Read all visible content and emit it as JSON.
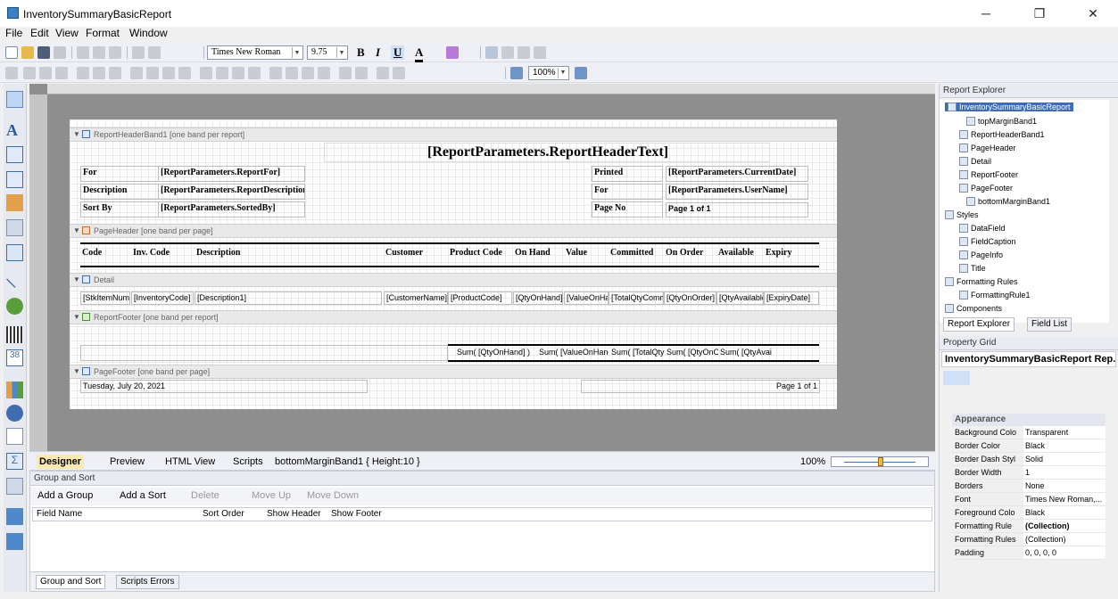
{
  "window": {
    "title": "InventorySummaryBasicReport",
    "minimize": "─",
    "maximize": "❐",
    "close": "✕"
  },
  "menu": [
    "File",
    "Edit",
    "View",
    "Format",
    "Window"
  ],
  "format_bar": {
    "font": "Times New Roman",
    "size": "9.75",
    "bold": "B",
    "italic": "I",
    "underline": "U",
    "font_color": "A"
  },
  "layout_bar": {
    "zoom": "100%"
  },
  "report": {
    "header_band": "ReportHeaderBand1 [one band per report]",
    "header_text": "[ReportParameters.ReportHeaderText]",
    "rows": [
      {
        "label": "For",
        "value": "[ReportParameters.ReportFor]",
        "rlabel": "Printed",
        "rvalue": "[ReportParameters.CurrentDate]"
      },
      {
        "label": "Description",
        "value": "[ReportParameters.ReportDescription]",
        "rlabel": "For",
        "rvalue": "[ReportParameters.UserName]"
      },
      {
        "label": "Sort By",
        "value": "[ReportParameters.SortedBy]",
        "rlabel": "Page No",
        "rvalue": "Page 1 of 1"
      }
    ],
    "page_header_band": "PageHeader [one band per page]",
    "columns": [
      "Code",
      "Inv. Code",
      "Description",
      "Customer",
      "Product Code",
      "On Hand",
      "Value",
      "Committed",
      "On Order",
      "Available",
      "Expiry"
    ],
    "detail_band": "Detail",
    "detail_fields": [
      "[StkItemNum]",
      "[InventoryCode]",
      "[Description1]",
      "[CustomerName]",
      "[ProductCode]",
      "[QtyOnHand]",
      "[ValueOnHand]",
      "[TotalQtyCommitted]",
      "[QtyOnOrder]",
      "[QtyAvailable]",
      "[ExpiryDate]"
    ],
    "footer_band": "ReportFooter [one band per report]",
    "footer_sums": [
      "Sum( [QtyOnHand] )",
      "Sum( [ValueOnHand] )",
      "Sum( [TotalQtyCommitted] )",
      "Sum( [QtyOnOrder] )",
      "Sum( [QtyAvailable] )"
    ],
    "page_footer_band": "PageFooter [one band per page]",
    "page_footer_date": "Tuesday, July 20, 2021",
    "page_footer_pages": "Page 1 of 1"
  },
  "designer_tabs": {
    "designer": "Designer",
    "preview": "Preview",
    "html": "HTML View",
    "scripts": "Scripts",
    "selection": "bottomMarginBand1 { Height:10 }",
    "zoom": "100%"
  },
  "group_sort": {
    "title": "Group and Sort",
    "add_group": "Add a Group",
    "add_sort": "Add a Sort",
    "delete": "Delete",
    "move_up": "Move Up",
    "move_down": "Move Down",
    "headers": [
      "Field Name",
      "Sort Order",
      "Show Header",
      "Show Footer"
    ],
    "tab1": "Group and Sort",
    "tab2": "Scripts Errors"
  },
  "explorer": {
    "title": "Report Explorer",
    "items": [
      "InventorySummaryBasicReport",
      "topMarginBand1",
      "ReportHeaderBand1",
      "PageHeader",
      "Detail",
      "ReportFooter",
      "PageFooter",
      "bottomMarginBand1",
      "Styles",
      "DataField",
      "FieldCaption",
      "PageInfo",
      "Title",
      "Formatting Rules",
      "FormattingRule1",
      "Components"
    ],
    "tab1": "Report Explorer",
    "tab2": "Field List"
  },
  "props": {
    "title": "Property Grid",
    "object": "InventorySummaryBasicReport  Rep...",
    "category": "Appearance",
    "rows": [
      {
        "k": "Background Colo",
        "v": "Transparent"
      },
      {
        "k": "Border Color",
        "v": "Black"
      },
      {
        "k": "Border Dash Styl",
        "v": "Solid"
      },
      {
        "k": "Border Width",
        "v": "1"
      },
      {
        "k": "Borders",
        "v": "None"
      },
      {
        "k": "Font",
        "v": "Times New Roman,..."
      },
      {
        "k": "Foreground Colo",
        "v": "Black"
      },
      {
        "k": "Formatting Rule",
        "v": "(Collection)"
      },
      {
        "k": "Formatting Rules",
        "v": "(Collection)"
      },
      {
        "k": "Padding",
        "v": "0, 0, 0, 0"
      }
    ]
  }
}
